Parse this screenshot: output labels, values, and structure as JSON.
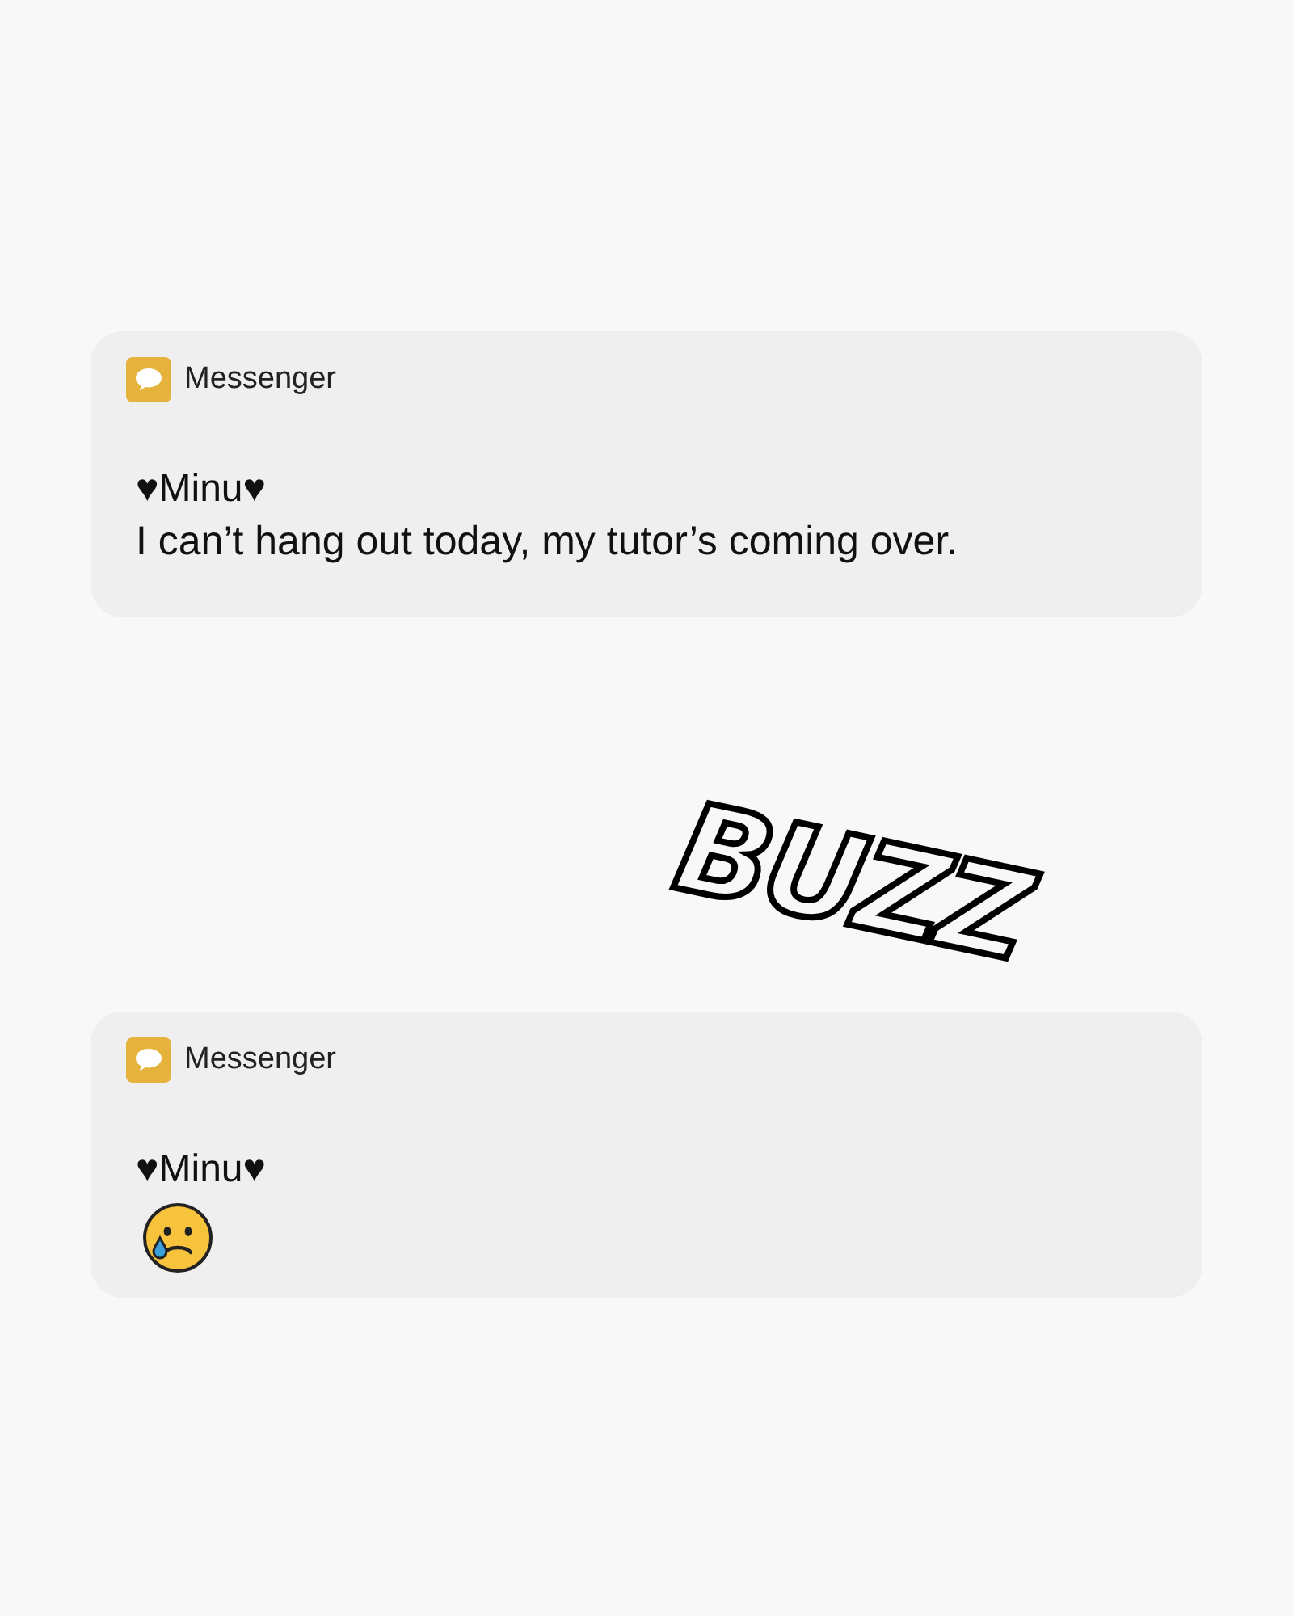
{
  "items": [
    {
      "kind": "notification",
      "app": "Messenger",
      "sender": "♥Minu♥",
      "content": [
        {
          "kind": "text",
          "text": "I can’t hang out today, my tutor’s coming over."
        }
      ]
    },
    {
      "kind": "sound_effect",
      "text": "BUZZ"
    },
    {
      "kind": "notification",
      "app": "Messenger",
      "sender": "♥Minu♥",
      "content": [
        {
          "kind": "emoji"
        }
      ]
    }
  ]
}
